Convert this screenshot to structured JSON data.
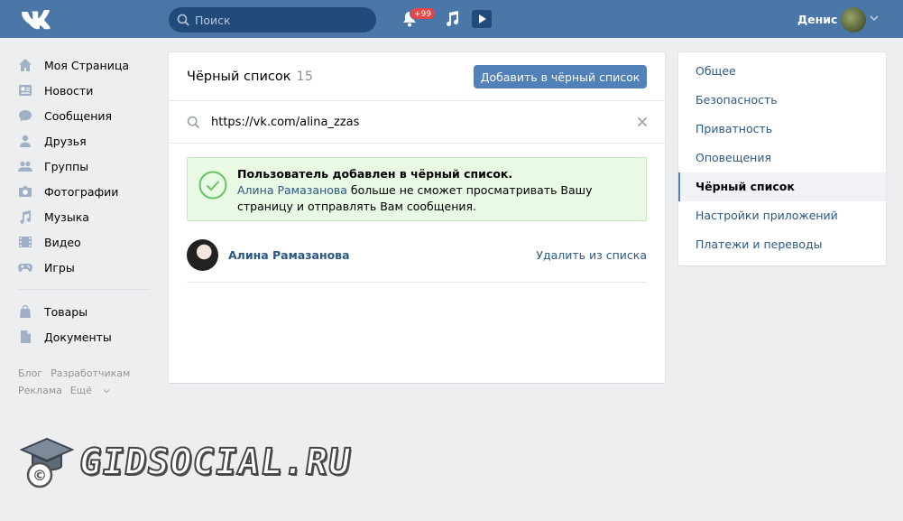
{
  "topbar": {
    "search_placeholder": "Поиск",
    "notifications_badge": "+99",
    "user_name": "Денис"
  },
  "sidebar": {
    "items": [
      {
        "label": "Моя Страница",
        "icon": "home-icon"
      },
      {
        "label": "Новости",
        "icon": "news-icon"
      },
      {
        "label": "Сообщения",
        "icon": "messages-icon"
      },
      {
        "label": "Друзья",
        "icon": "friends-icon"
      },
      {
        "label": "Группы",
        "icon": "groups-icon"
      },
      {
        "label": "Фотографии",
        "icon": "camera-icon"
      },
      {
        "label": "Музыка",
        "icon": "music-icon"
      },
      {
        "label": "Видео",
        "icon": "video-icon"
      },
      {
        "label": "Игры",
        "icon": "gamepad-icon"
      }
    ],
    "items2": [
      {
        "label": "Товары",
        "icon": "bag-icon"
      },
      {
        "label": "Документы",
        "icon": "document-icon"
      }
    ],
    "footer": {
      "blog": "Блог",
      "developers": "Разработчикам",
      "ads": "Реклама",
      "more": "Ещё"
    }
  },
  "main": {
    "title": "Чёрный список",
    "count": "15",
    "add_button": "Добавить в чёрный список",
    "search_value": "https://vk.com/alina_zzas",
    "alert": {
      "heading": "Пользователь добавлен в чёрный список.",
      "user_link": "Алина Рамазанова",
      "body": " больше не сможет просматривать Вашу страницу и отправлять Вам сообщения."
    },
    "entry": {
      "name": "Алина Рамазанова",
      "remove": "Удалить из списка"
    }
  },
  "settings_menu": {
    "items": [
      "Общее",
      "Безопасность",
      "Приватность",
      "Оповещения",
      "Чёрный список",
      "Настройки приложений",
      "Платежи и переводы"
    ],
    "active_index": 4
  },
  "watermark": {
    "text": "GIDSOCIAL.RU"
  },
  "colors": {
    "header": "#4a76a8",
    "accent": "#5181b8",
    "link": "#2a5885",
    "success_bg": "#e8f9e4"
  }
}
